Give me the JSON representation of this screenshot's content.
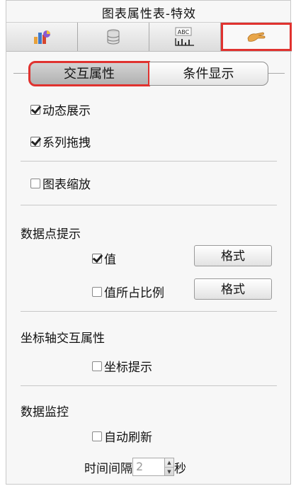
{
  "title": "图表属性表-特效",
  "tabs": [
    {
      "icon": "chart-style-icon",
      "active": false
    },
    {
      "icon": "database-icon",
      "active": false
    },
    {
      "icon": "text-label-icon",
      "active": false,
      "badge": "ABC"
    },
    {
      "icon": "hand-effect-icon",
      "active": true
    }
  ],
  "subtabs": {
    "interaction": "交互属性",
    "condition": "条件显示"
  },
  "interaction": {
    "dynamic_display": {
      "label": "动态展示",
      "checked": true
    },
    "series_drag": {
      "label": "系列拖拽",
      "checked": true
    },
    "chart_zoom": {
      "label": "图表缩放",
      "checked": false
    }
  },
  "datapoint_tip": {
    "heading": "数据点提示",
    "value": {
      "label": "值",
      "checked": true
    },
    "percent": {
      "label": "值所占比例",
      "checked": false
    },
    "format_label": "格式"
  },
  "axis": {
    "heading": "坐标轴交互属性",
    "coord_tip": {
      "label": "坐标提示",
      "checked": false
    }
  },
  "monitor": {
    "heading": "数据监控",
    "auto_refresh": {
      "label": "自动刷新",
      "checked": false
    },
    "interval_label": "时间间隔",
    "interval_value": "2",
    "unit": "秒"
  },
  "colors": {
    "highlight": "#e0322f",
    "accent": "#e8a64a"
  }
}
